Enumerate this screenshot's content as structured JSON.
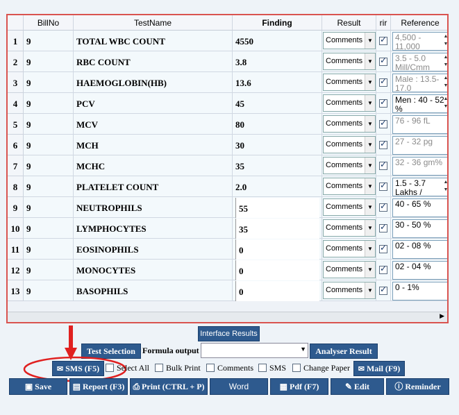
{
  "columns": {
    "row": "",
    "billno": "BillNo",
    "testname": "TestName",
    "finding": "Finding",
    "result": "Result",
    "print": "rir",
    "reference": "Reference"
  },
  "rows": [
    {
      "n": "1",
      "bill": "9",
      "test": "TOTAL WBC COUNT",
      "finding": "4550",
      "result": "Comments",
      "ref": "4,500 - 11,000"
    },
    {
      "n": "2",
      "bill": "9",
      "test": "RBC COUNT",
      "finding": "3.8",
      "result": "Comments",
      "ref": "3.5 - 5.0 Mill/Cmm"
    },
    {
      "n": "3",
      "bill": "9",
      "test": "HAEMOGLOBIN(HB)",
      "finding": "13.6",
      "result": "Comments",
      "ref": "Male : 13.5-17.0"
    },
    {
      "n": "4",
      "bill": "9",
      "test": "PCV",
      "finding": "45",
      "result": "Comments",
      "ref": "Men : 40 - 52 %"
    },
    {
      "n": "5",
      "bill": "9",
      "test": "MCV",
      "finding": "80",
      "result": "Comments",
      "ref": "76 - 96 fL"
    },
    {
      "n": "6",
      "bill": "9",
      "test": "MCH",
      "finding": "30",
      "result": "Comments",
      "ref": "27 - 32 pg"
    },
    {
      "n": "7",
      "bill": "9",
      "test": "MCHC",
      "finding": "35",
      "result": "Comments",
      "ref": "32 - 36 gm%"
    },
    {
      "n": "8",
      "bill": "9",
      "test": "PLATELET COUNT",
      "finding": "2.0",
      "result": "Comments",
      "ref": "1.5 - 3.7 Lakhs /"
    },
    {
      "n": "9",
      "bill": "9",
      "test": "NEUTROPHILS",
      "finding": "55",
      "result": "Comments",
      "ref": "40 - 65 %"
    },
    {
      "n": "10",
      "bill": "9",
      "test": "LYMPHOCYTES",
      "finding": "35",
      "result": "Comments",
      "ref": "30 - 50 %"
    },
    {
      "n": "11",
      "bill": "9",
      "test": "EOSINOPHILS",
      "finding": "0",
      "result": "Comments",
      "ref": "02 - 08 %"
    },
    {
      "n": "12",
      "bill": "9",
      "test": "MONOCYTES",
      "finding": "0",
      "result": "Comments",
      "ref": "02 - 04 %"
    },
    {
      "n": "13",
      "bill": "9",
      "test": "BASOPHILS",
      "finding": "0",
      "result": "Comments",
      "ref": "0 - 1%"
    }
  ],
  "buttons": {
    "interface_results": "Interface Results",
    "test_selection": "Test Selection",
    "formula_output": "Formula output",
    "formula_value": "",
    "analyser_result": "Analyser Result",
    "sms": "SMS (F5)",
    "mail": "Mail (F9)"
  },
  "options": {
    "select_all": "Select All",
    "bulk_print": "Bulk Print",
    "comments": "Comments",
    "sms": "SMS",
    "change_paper": "Change Paper"
  },
  "toolbar": {
    "save": "Save",
    "report": "Report (F3)",
    "print": "Print (CTRL + P)",
    "word": "Word",
    "pdf": "Pdf (F7)",
    "edit": "Edit",
    "reminder": "Reminder"
  },
  "colors": {
    "accent": "#2e5a8e",
    "highlight_circle": "#e02020"
  }
}
